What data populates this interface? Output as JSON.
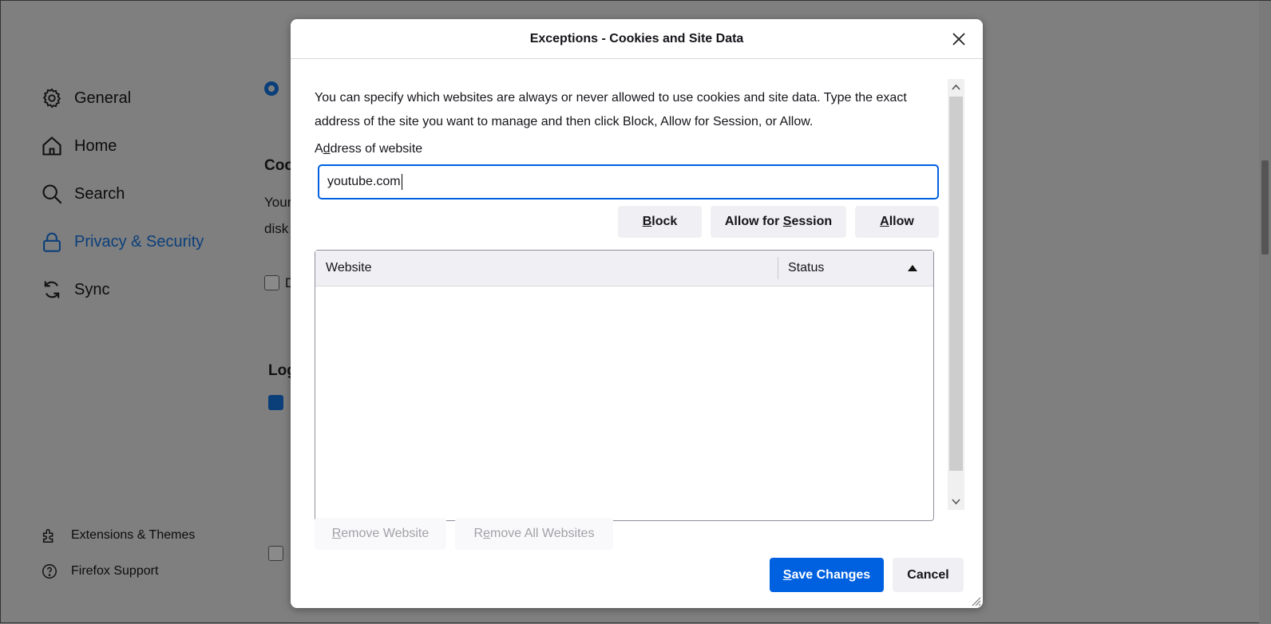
{
  "sidebar": {
    "items": [
      {
        "label": "General",
        "icon": "gear-icon"
      },
      {
        "label": "Home",
        "icon": "home-icon"
      },
      {
        "label": "Search",
        "icon": "search-icon"
      },
      {
        "label": "Privacy & Security",
        "icon": "lock-icon",
        "active": true
      },
      {
        "label": "Sync",
        "icon": "sync-icon"
      }
    ],
    "footer": [
      {
        "label": "Extensions & Themes",
        "icon": "puzzle-icon"
      },
      {
        "label": "Firefox Support",
        "icon": "help-icon"
      }
    ]
  },
  "background": {
    "heading_cookies": "Coo",
    "text1": "Your",
    "text2": "disk",
    "heading_logins": "Log",
    "checkbox_d": "D"
  },
  "dialog": {
    "title": "Exceptions - Cookies and Site Data",
    "description": "You can specify which websites are always or never allowed to use cookies and site data. Type the exact address of the site you want to manage and then click Block, Allow for Session, or Allow.",
    "address_label_pre": "A",
    "address_label_u": "d",
    "address_label_post": "dress of website",
    "address_value": "youtube.com",
    "buttons": {
      "block_u": "B",
      "block": "lock",
      "session_pre": "Allow for ",
      "session_u": "S",
      "session": "ession",
      "allow_u": "A",
      "allow": "llow"
    },
    "table": {
      "columns": [
        "Website",
        "Status"
      ],
      "sort": "ascending",
      "rows": []
    },
    "remove_website_u": "R",
    "remove_website": "emove Website",
    "remove_all_pre": "R",
    "remove_all_u": "e",
    "remove_all": "move All Websites",
    "save_u": "S",
    "save": "ave Changes",
    "cancel": "Cancel"
  },
  "colors": {
    "accent": "#0061e0",
    "overlay": "#7f7f7f"
  }
}
